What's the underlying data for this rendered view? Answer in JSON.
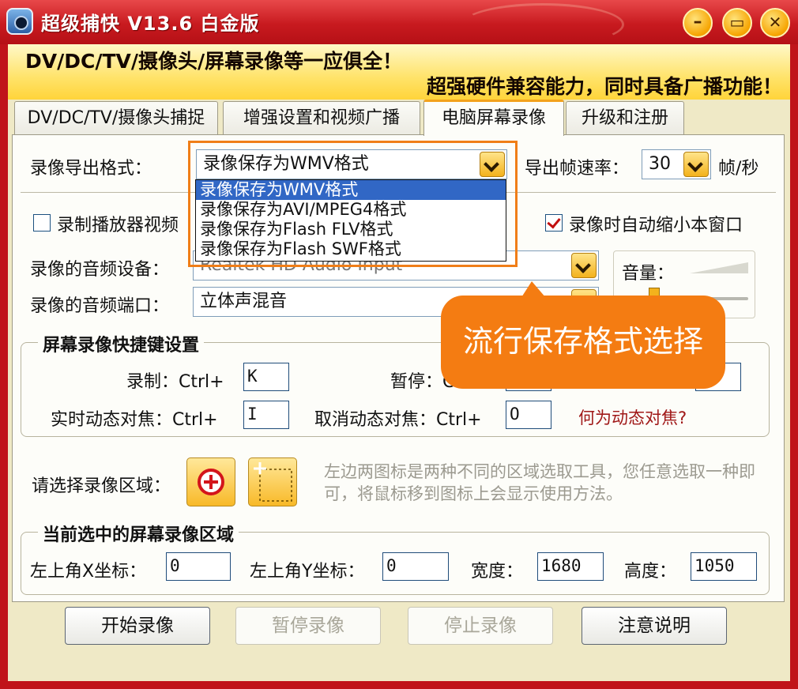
{
  "window": {
    "title": "超级捕快  V13.6  白金版",
    "controls": {
      "minimize": "–",
      "maximize": "▭",
      "close": "✕"
    }
  },
  "banner": {
    "line1": "DV/DC/TV/摄像头/屏幕录像等一应俱全！",
    "line2": "超强硬件兼容能力，同时具备广播功能！"
  },
  "tabs": [
    {
      "label": "DV/DC/TV/摄像头捕捉"
    },
    {
      "label": "增强设置和视频广播"
    },
    {
      "label": "电脑屏幕录像"
    },
    {
      "label": "升级和注册"
    }
  ],
  "export": {
    "format_label": "录像导出格式：",
    "format_value": "录像保存为WMV格式",
    "fps_label": "导出帧速率：",
    "fps_value": "30",
    "fps_unit": "帧/秒",
    "options": [
      "录像保存为WMV格式",
      "录像保存为AVI/MPEG4格式",
      "录像保存为Flash FLV格式",
      "录像保存为Flash SWF格式"
    ]
  },
  "checkboxes": {
    "record_player": "录制播放器视频",
    "auto_minimize": "录像时自动缩小本窗口"
  },
  "audio": {
    "device_label": "录像的音频设备：",
    "device_value": "Realtek HD Audio Input",
    "port_label": "录像的音频端口：",
    "port_value": "立体声混音",
    "volume_label": "音量："
  },
  "hotkeys": {
    "title": "屏幕录像快捷键设置",
    "record_label": "录制：Ctrl+",
    "record_key": "K",
    "pause_label": "暂停：Ctrl+",
    "focus_label": "实时动态对焦：Ctrl+",
    "focus_key": "I",
    "cancel_focus_label": "取消动态对焦：Ctrl+",
    "cancel_focus_key": "O",
    "help_link": "何为动态对焦?"
  },
  "region": {
    "label": "请选择录像区域：",
    "hint": "左边两图标是两种不同的区域选取工具，您任意选取一种即可，将鼠标移到图标上会显示使用方法。",
    "icons": [
      "crosshair-icon",
      "select-area-icon"
    ]
  },
  "current_region": {
    "title": "当前选中的屏幕录像区域",
    "x_label": "左上角X坐标：",
    "x_value": "0",
    "y_label": "左上角Y坐标：",
    "y_value": "0",
    "width_label": "宽度：",
    "width_value": "1680",
    "height_label": "高度：",
    "height_value": "1050"
  },
  "buttons": {
    "start": "开始录像",
    "pause": "暂停录像",
    "stop": "停止录像",
    "notes": "注意说明"
  },
  "callout": {
    "text": "流行保存格式选择"
  },
  "colors": {
    "title_red": "#c0141a",
    "accent_orange": "#f47c12",
    "selection_blue": "#3167c5",
    "link_red": "#a01818"
  }
}
